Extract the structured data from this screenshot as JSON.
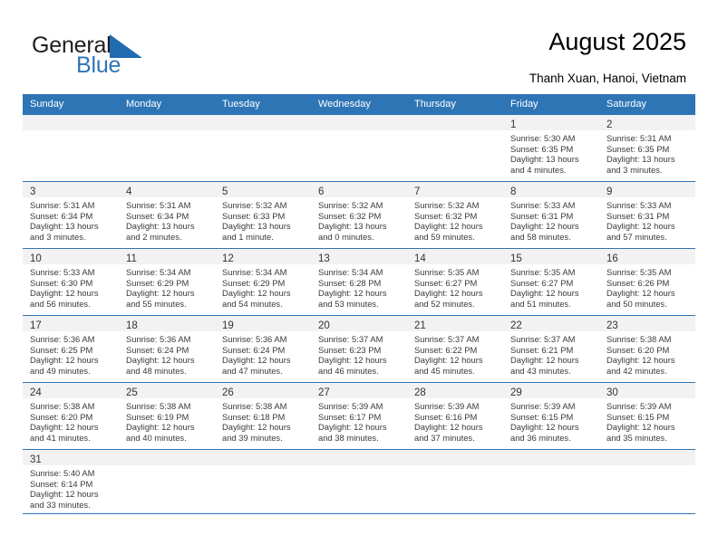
{
  "brand": {
    "name_part1": "General",
    "name_part2": "Blue",
    "logo_icon": "blue-flag-triangle-icon",
    "color_dark": "#231f20",
    "color_blue": "#2e75b6"
  },
  "header": {
    "title": "August 2025",
    "subtitle": "Thanh Xuan, Hanoi, Vietnam"
  },
  "calendar": {
    "accent_color": "#2e75b6",
    "daynum_band_color": "#f2f2f2",
    "weekdays": [
      "Sunday",
      "Monday",
      "Tuesday",
      "Wednesday",
      "Thursday",
      "Friday",
      "Saturday"
    ],
    "weeks": [
      [
        {
          "day": "",
          "empty": true
        },
        {
          "day": "",
          "empty": true
        },
        {
          "day": "",
          "empty": true
        },
        {
          "day": "",
          "empty": true
        },
        {
          "day": "",
          "empty": true
        },
        {
          "day": "1",
          "sunrise": "Sunrise: 5:30 AM",
          "sunset": "Sunset: 6:35 PM",
          "daylight_line1": "Daylight: 13 hours",
          "daylight_line2": "and 4 minutes."
        },
        {
          "day": "2",
          "sunrise": "Sunrise: 5:31 AM",
          "sunset": "Sunset: 6:35 PM",
          "daylight_line1": "Daylight: 13 hours",
          "daylight_line2": "and 3 minutes."
        }
      ],
      [
        {
          "day": "3",
          "sunrise": "Sunrise: 5:31 AM",
          "sunset": "Sunset: 6:34 PM",
          "daylight_line1": "Daylight: 13 hours",
          "daylight_line2": "and 3 minutes."
        },
        {
          "day": "4",
          "sunrise": "Sunrise: 5:31 AM",
          "sunset": "Sunset: 6:34 PM",
          "daylight_line1": "Daylight: 13 hours",
          "daylight_line2": "and 2 minutes."
        },
        {
          "day": "5",
          "sunrise": "Sunrise: 5:32 AM",
          "sunset": "Sunset: 6:33 PM",
          "daylight_line1": "Daylight: 13 hours",
          "daylight_line2": "and 1 minute."
        },
        {
          "day": "6",
          "sunrise": "Sunrise: 5:32 AM",
          "sunset": "Sunset: 6:32 PM",
          "daylight_line1": "Daylight: 13 hours",
          "daylight_line2": "and 0 minutes."
        },
        {
          "day": "7",
          "sunrise": "Sunrise: 5:32 AM",
          "sunset": "Sunset: 6:32 PM",
          "daylight_line1": "Daylight: 12 hours",
          "daylight_line2": "and 59 minutes."
        },
        {
          "day": "8",
          "sunrise": "Sunrise: 5:33 AM",
          "sunset": "Sunset: 6:31 PM",
          "daylight_line1": "Daylight: 12 hours",
          "daylight_line2": "and 58 minutes."
        },
        {
          "day": "9",
          "sunrise": "Sunrise: 5:33 AM",
          "sunset": "Sunset: 6:31 PM",
          "daylight_line1": "Daylight: 12 hours",
          "daylight_line2": "and 57 minutes."
        }
      ],
      [
        {
          "day": "10",
          "sunrise": "Sunrise: 5:33 AM",
          "sunset": "Sunset: 6:30 PM",
          "daylight_line1": "Daylight: 12 hours",
          "daylight_line2": "and 56 minutes."
        },
        {
          "day": "11",
          "sunrise": "Sunrise: 5:34 AM",
          "sunset": "Sunset: 6:29 PM",
          "daylight_line1": "Daylight: 12 hours",
          "daylight_line2": "and 55 minutes."
        },
        {
          "day": "12",
          "sunrise": "Sunrise: 5:34 AM",
          "sunset": "Sunset: 6:29 PM",
          "daylight_line1": "Daylight: 12 hours",
          "daylight_line2": "and 54 minutes."
        },
        {
          "day": "13",
          "sunrise": "Sunrise: 5:34 AM",
          "sunset": "Sunset: 6:28 PM",
          "daylight_line1": "Daylight: 12 hours",
          "daylight_line2": "and 53 minutes."
        },
        {
          "day": "14",
          "sunrise": "Sunrise: 5:35 AM",
          "sunset": "Sunset: 6:27 PM",
          "daylight_line1": "Daylight: 12 hours",
          "daylight_line2": "and 52 minutes."
        },
        {
          "day": "15",
          "sunrise": "Sunrise: 5:35 AM",
          "sunset": "Sunset: 6:27 PM",
          "daylight_line1": "Daylight: 12 hours",
          "daylight_line2": "and 51 minutes."
        },
        {
          "day": "16",
          "sunrise": "Sunrise: 5:35 AM",
          "sunset": "Sunset: 6:26 PM",
          "daylight_line1": "Daylight: 12 hours",
          "daylight_line2": "and 50 minutes."
        }
      ],
      [
        {
          "day": "17",
          "sunrise": "Sunrise: 5:36 AM",
          "sunset": "Sunset: 6:25 PM",
          "daylight_line1": "Daylight: 12 hours",
          "daylight_line2": "and 49 minutes."
        },
        {
          "day": "18",
          "sunrise": "Sunrise: 5:36 AM",
          "sunset": "Sunset: 6:24 PM",
          "daylight_line1": "Daylight: 12 hours",
          "daylight_line2": "and 48 minutes."
        },
        {
          "day": "19",
          "sunrise": "Sunrise: 5:36 AM",
          "sunset": "Sunset: 6:24 PM",
          "daylight_line1": "Daylight: 12 hours",
          "daylight_line2": "and 47 minutes."
        },
        {
          "day": "20",
          "sunrise": "Sunrise: 5:37 AM",
          "sunset": "Sunset: 6:23 PM",
          "daylight_line1": "Daylight: 12 hours",
          "daylight_line2": "and 46 minutes."
        },
        {
          "day": "21",
          "sunrise": "Sunrise: 5:37 AM",
          "sunset": "Sunset: 6:22 PM",
          "daylight_line1": "Daylight: 12 hours",
          "daylight_line2": "and 45 minutes."
        },
        {
          "day": "22",
          "sunrise": "Sunrise: 5:37 AM",
          "sunset": "Sunset: 6:21 PM",
          "daylight_line1": "Daylight: 12 hours",
          "daylight_line2": "and 43 minutes."
        },
        {
          "day": "23",
          "sunrise": "Sunrise: 5:38 AM",
          "sunset": "Sunset: 6:20 PM",
          "daylight_line1": "Daylight: 12 hours",
          "daylight_line2": "and 42 minutes."
        }
      ],
      [
        {
          "day": "24",
          "sunrise": "Sunrise: 5:38 AM",
          "sunset": "Sunset: 6:20 PM",
          "daylight_line1": "Daylight: 12 hours",
          "daylight_line2": "and 41 minutes."
        },
        {
          "day": "25",
          "sunrise": "Sunrise: 5:38 AM",
          "sunset": "Sunset: 6:19 PM",
          "daylight_line1": "Daylight: 12 hours",
          "daylight_line2": "and 40 minutes."
        },
        {
          "day": "26",
          "sunrise": "Sunrise: 5:38 AM",
          "sunset": "Sunset: 6:18 PM",
          "daylight_line1": "Daylight: 12 hours",
          "daylight_line2": "and 39 minutes."
        },
        {
          "day": "27",
          "sunrise": "Sunrise: 5:39 AM",
          "sunset": "Sunset: 6:17 PM",
          "daylight_line1": "Daylight: 12 hours",
          "daylight_line2": "and 38 minutes."
        },
        {
          "day": "28",
          "sunrise": "Sunrise: 5:39 AM",
          "sunset": "Sunset: 6:16 PM",
          "daylight_line1": "Daylight: 12 hours",
          "daylight_line2": "and 37 minutes."
        },
        {
          "day": "29",
          "sunrise": "Sunrise: 5:39 AM",
          "sunset": "Sunset: 6:15 PM",
          "daylight_line1": "Daylight: 12 hours",
          "daylight_line2": "and 36 minutes."
        },
        {
          "day": "30",
          "sunrise": "Sunrise: 5:39 AM",
          "sunset": "Sunset: 6:15 PM",
          "daylight_line1": "Daylight: 12 hours",
          "daylight_line2": "and 35 minutes."
        }
      ],
      [
        {
          "day": "31",
          "sunrise": "Sunrise: 5:40 AM",
          "sunset": "Sunset: 6:14 PM",
          "daylight_line1": "Daylight: 12 hours",
          "daylight_line2": "and 33 minutes."
        },
        {
          "day": "",
          "empty": true
        },
        {
          "day": "",
          "empty": true
        },
        {
          "day": "",
          "empty": true
        },
        {
          "day": "",
          "empty": true
        },
        {
          "day": "",
          "empty": true
        },
        {
          "day": "",
          "empty": true
        }
      ]
    ]
  }
}
